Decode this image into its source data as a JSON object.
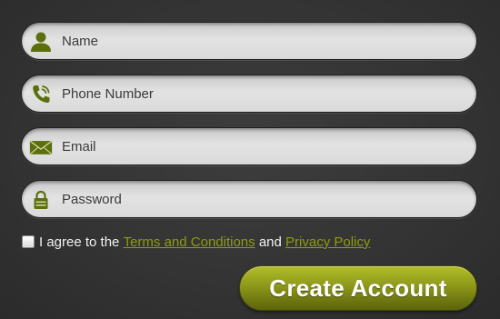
{
  "form": {
    "fields": [
      {
        "icon": "user-icon",
        "placeholder": "Name",
        "value": ""
      },
      {
        "icon": "phone-icon",
        "placeholder": "Phone Number",
        "value": ""
      },
      {
        "icon": "envelope-icon",
        "placeholder": "Email",
        "value": ""
      },
      {
        "icon": "lock-icon",
        "placeholder": "Password",
        "value": ""
      }
    ],
    "terms": {
      "checked": false,
      "prefix": "I agree to the",
      "terms_link": "Terms and Conditions",
      "conjunction": "and",
      "privacy_link": "Privacy Policy"
    },
    "submit_label": "Create Account"
  },
  "colors": {
    "background": "#353535",
    "field_fill": "#dcdcdc",
    "icon_olive": "#5b6f0c",
    "link_olive": "#8e9b12",
    "button_olive": "#8d9819"
  }
}
